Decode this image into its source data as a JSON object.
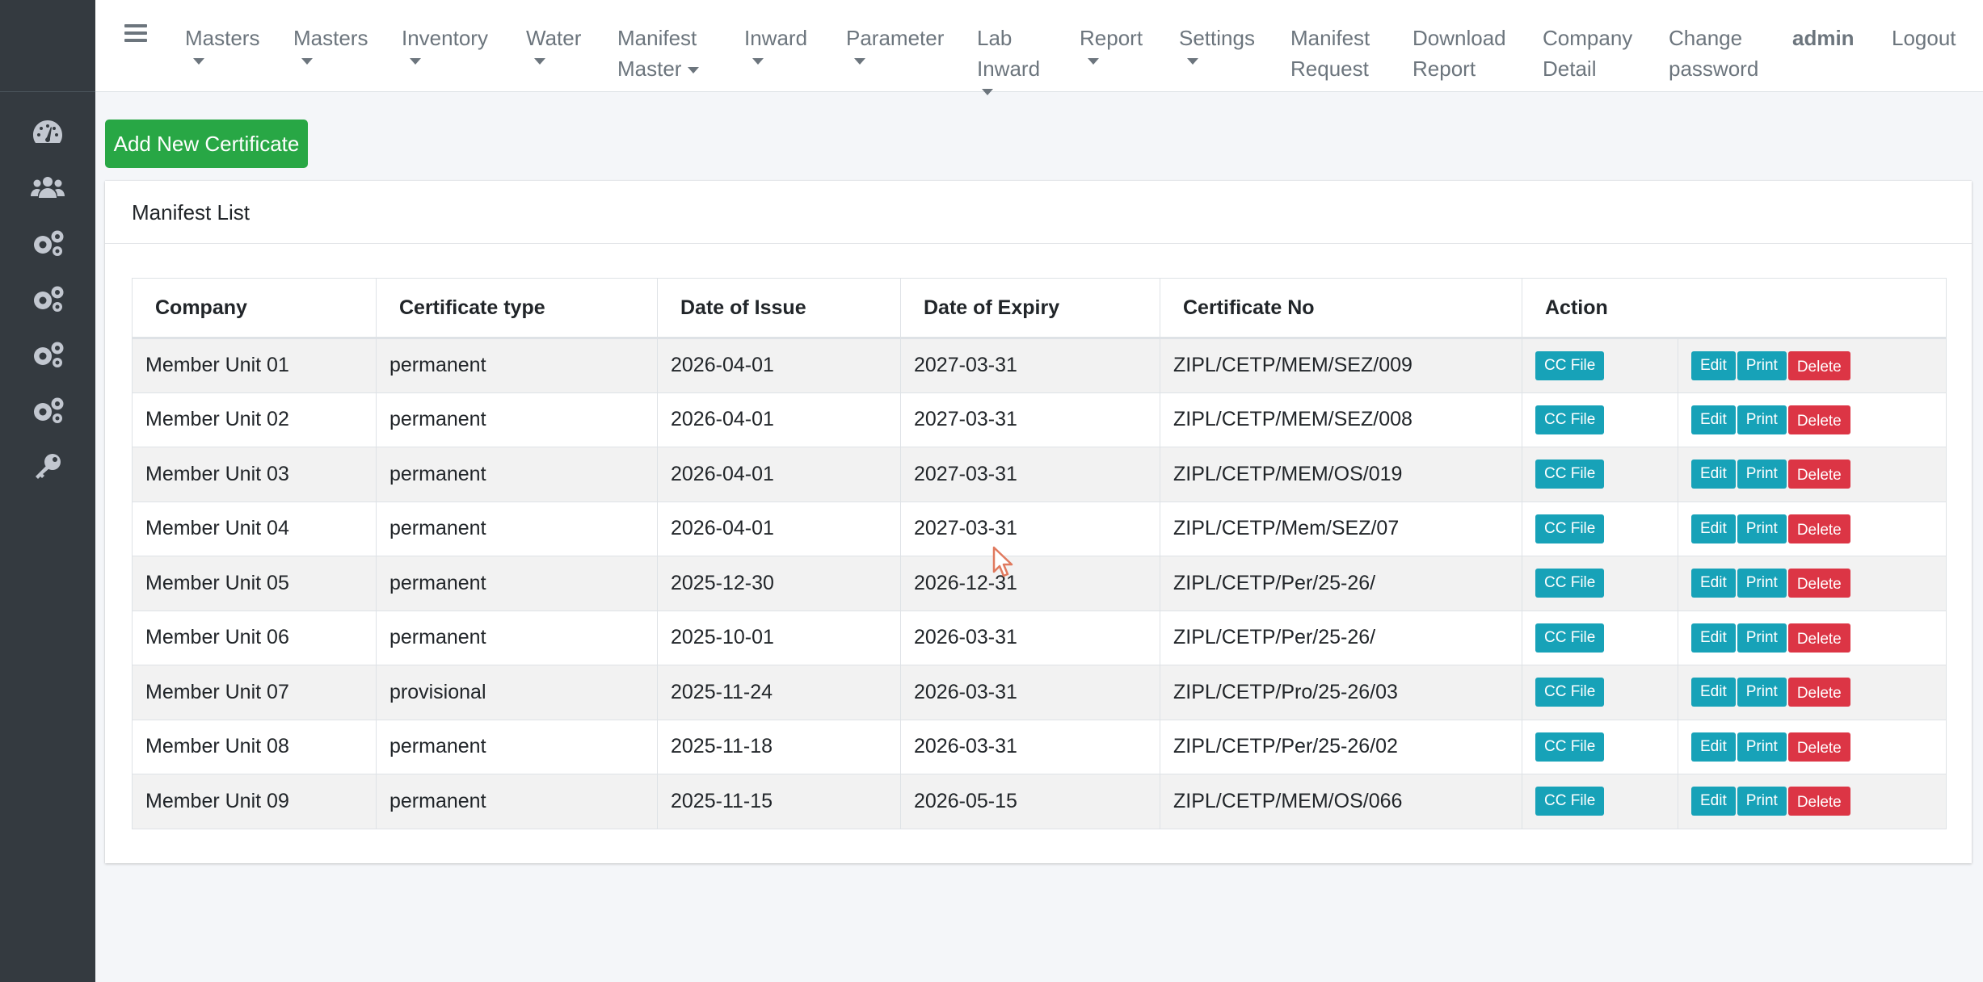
{
  "sidebar": {
    "icons": [
      "dashboard-icon",
      "users-icon",
      "gears-icon",
      "gears-icon",
      "gears-icon",
      "gears-icon",
      "key-icon"
    ]
  },
  "nav": {
    "items": [
      {
        "label": "Masters",
        "dropdown": true
      },
      {
        "label": "Masters",
        "dropdown": true
      },
      {
        "label": "Inventory",
        "dropdown": true
      },
      {
        "label": "Water",
        "dropdown": true
      },
      {
        "label": "Manifest Master",
        "dropdown": true
      },
      {
        "label": "Inward",
        "dropdown": true
      },
      {
        "label": "Parameter",
        "dropdown": true
      },
      {
        "label": "Lab Inward",
        "dropdown": true
      },
      {
        "label": "Report",
        "dropdown": true
      },
      {
        "label": "Settings",
        "dropdown": true
      },
      {
        "label": "Manifest Request",
        "dropdown": false
      },
      {
        "label": "Download Report",
        "dropdown": false
      },
      {
        "label": "Company Detail",
        "dropdown": false
      },
      {
        "label": "Change password",
        "dropdown": false
      }
    ],
    "user": "admin",
    "logout": "Logout"
  },
  "add_button": "Add New Certificate",
  "card_title": "Manifest List",
  "table": {
    "headers": [
      "Company",
      "Certificate type",
      "Date of Issue",
      "Date of Expiry",
      "Certificate No",
      "Action"
    ],
    "cc_label": "CC File",
    "edit_label": "Edit",
    "print_label": "Print",
    "delete_label": "Delete",
    "rows": [
      [
        "Member Unit 01",
        "permanent",
        "2026-04-01",
        "2027-03-31",
        "ZIPL/CETP/MEM/SEZ/009"
      ],
      [
        "Member Unit 02",
        "permanent",
        "2026-04-01",
        "2027-03-31",
        "ZIPL/CETP/MEM/SEZ/008"
      ],
      [
        "Member Unit 03",
        "permanent",
        "2026-04-01",
        "2027-03-31",
        "ZIPL/CETP/MEM/OS/019"
      ],
      [
        "Member Unit 04",
        "permanent",
        "2026-04-01",
        "2027-03-31",
        "ZIPL/CETP/Mem/SEZ/07"
      ],
      [
        "Member Unit 05",
        "permanent",
        "2025-12-30",
        "2026-12-31",
        "ZIPL/CETP/Per/25-26/"
      ],
      [
        "Member Unit 06",
        "permanent",
        "2025-10-01",
        "2026-03-31",
        "ZIPL/CETP/Per/25-26/"
      ],
      [
        "Member Unit 07",
        "provisional",
        "2025-11-24",
        "2026-03-31",
        "ZIPL/CETP/Pro/25-26/03"
      ],
      [
        "Member Unit 08",
        "permanent",
        "2025-11-18",
        "2026-03-31",
        "ZIPL/CETP/Per/25-26/02"
      ],
      [
        "Member Unit 09",
        "permanent",
        "2025-11-15",
        "2026-05-15",
        "ZIPL/CETP/MEM/OS/066"
      ]
    ]
  },
  "colors": {
    "sidebar": "#343a40",
    "success": "#28a745",
    "info": "#17a2b8",
    "danger": "#dc3545"
  }
}
